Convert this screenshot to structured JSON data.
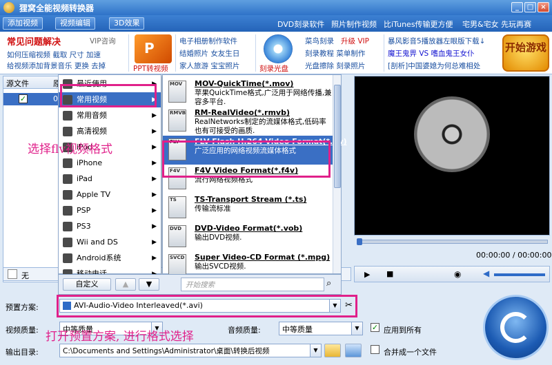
{
  "window": {
    "title": "狸窝全能视频转换器"
  },
  "toolbar": {
    "add_video": "添加视频",
    "edit_video": "视频编辑",
    "effect_3d": "3D效果",
    "links": [
      "DVD刻录软件",
      "照片制作视频",
      "比iTunes传输更方便",
      "宅男&宅女 先玩再赛"
    ]
  },
  "ads": {
    "faq_title": "常见问题解决",
    "vip": "VIP咨询",
    "faq_lines": [
      "如何压缩视频 截取 尺寸 加速",
      "给视频添加背景音乐 更换 去掉"
    ],
    "ppt_label": "PPT转视频",
    "photo_lines": [
      "电子相册制作软件",
      "结婚照片 女友生日",
      "家人旅游 宝宝照片"
    ],
    "cd_label": "刻录光盘",
    "burn_lines": [
      "菜鸟刻录",
      "升级 VIP",
      "刻录教程 菜单制作",
      "光盘擦除 刻录照片"
    ],
    "news_lines": [
      "暴风影音5播放器左眼版下载↓",
      "魔王鬼畀 VS 嗜血鬼王女仆",
      "[剖析]中国婆媳为何总难相处"
    ],
    "game_btn": "开始游戏"
  },
  "filelist": {
    "col1": "源文件",
    "col2": "原",
    "row_num": "0"
  },
  "subtitle_row": {
    "value": "无"
  },
  "category_menu": {
    "items": [
      {
        "label": "最近使用",
        "arrow": true
      },
      {
        "label": "常用视频",
        "arrow": true,
        "selected": true
      },
      {
        "label": "常用音频",
        "arrow": true
      },
      {
        "label": "高清视频",
        "arrow": true
      },
      {
        "label": "iPod",
        "arrow": true
      },
      {
        "label": "iPhone",
        "arrow": true
      },
      {
        "label": "iPad",
        "arrow": true
      },
      {
        "label": "Apple TV",
        "arrow": true
      },
      {
        "label": "PSP",
        "arrow": true
      },
      {
        "label": "PS3",
        "arrow": true
      },
      {
        "label": "Wii and DS",
        "arrow": true
      },
      {
        "label": "Android系统",
        "arrow": true
      },
      {
        "label": "移动电话",
        "arrow": true
      }
    ]
  },
  "format_list": {
    "items": [
      {
        "icon": "MOV",
        "name": "MOV-QuickTime(*.mov)",
        "desc": "苹果QuickTime格式,广泛用于网络传播,兼容多平台."
      },
      {
        "icon": "RMVB",
        "name": "RM-RealVideo(*.rmvb)",
        "desc": "RealNetworks制定的流媒体格式,低码率也有可接受的画质."
      },
      {
        "icon": "FLV",
        "name": "FLV-Flash H.264 Video Format(*.flv)",
        "desc": "广泛应用的网络视频流媒体格式",
        "selected": true
      },
      {
        "icon": "F4V",
        "name": "F4V Video Format(*.f4v)",
        "desc": "流行网络视频格式"
      },
      {
        "icon": "TS",
        "name": "TS-Transport Stream (*.ts)",
        "desc": "传输流标准"
      },
      {
        "icon": "DVD",
        "name": "DVD-Video Format(*.vob)",
        "desc": "输出DVD视频."
      },
      {
        "icon": "SVCD",
        "name": "Super Video-CD Format (*.mpg)",
        "desc": "输出SVCD视频."
      }
    ]
  },
  "menu_bar": {
    "custom": "自定义",
    "search_placeholder": "开始搜索"
  },
  "preview": {
    "time": "00:00:00 / 00:00:00"
  },
  "settings": {
    "preset_label": "预置方案:",
    "preset_value": "AVI-Audio-Video Interleaved(*.avi)",
    "video_quality_label": "视频质量:",
    "video_quality_value": "中等质量",
    "audio_quality_label": "音频质量:",
    "audio_quality_value": "中等质量",
    "apply_all": "应用到所有",
    "output_label": "输出目录:",
    "output_value": "C:\\Documents and Settings\\Administrator\\桌面\\转换后视频",
    "merge": "合并成一个文件"
  },
  "annotations": {
    "select_flv": "选择flv视频格式",
    "open_preset": "打开预置方案, 进行格式选择"
  },
  "colors": {
    "annotation": "#e0208a",
    "selection": "#3a6fc4"
  }
}
